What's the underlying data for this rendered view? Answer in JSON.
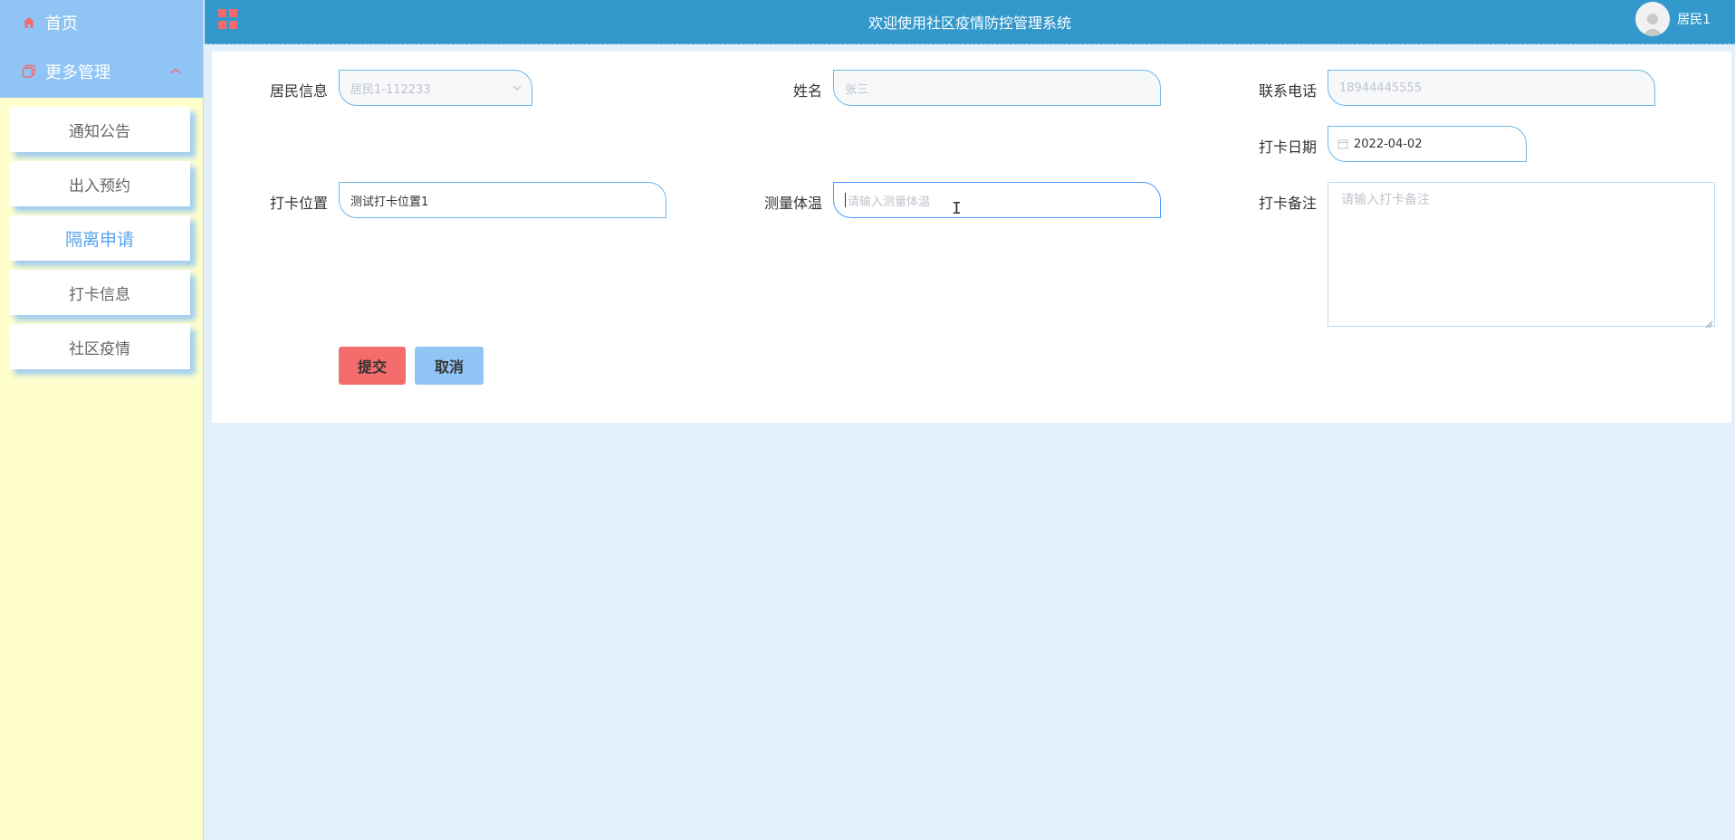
{
  "sidebar": {
    "home_label": "首页",
    "more_label": "更多管理",
    "items": [
      {
        "label": "通知公告"
      },
      {
        "label": "出入预约"
      },
      {
        "label": "隔离申请"
      },
      {
        "label": "打卡信息"
      },
      {
        "label": "社区疫情"
      }
    ],
    "active_index": 2
  },
  "header": {
    "title": "欢迎使用社区疫情防控管理系统",
    "user_name": "居民1"
  },
  "form": {
    "resident_label": "居民信息",
    "resident_value": "居民1-112233",
    "name_label": "姓名",
    "name_value": "张三",
    "phone_label": "联系电话",
    "phone_value": "18944445555",
    "date_label": "打卡日期",
    "date_value": "2022-04-02",
    "location_label": "打卡位置",
    "location_value": "测试打卡位置1",
    "temp_label": "测量体温",
    "temp_placeholder": "请输入测量体温",
    "note_label": "打卡备注",
    "note_placeholder": "请输入打卡备注",
    "submit_label": "提交",
    "cancel_label": "取消"
  },
  "colors": {
    "header_bg": "#3399cc",
    "sidebar_top_bg": "#8fc4f5",
    "sidebar_bg": "#ffffcc",
    "content_bg": "#e3f0fc",
    "submit_bg": "#f56c6c",
    "cancel_bg": "#8fc4f5",
    "accent_red": "#f36a6a"
  }
}
